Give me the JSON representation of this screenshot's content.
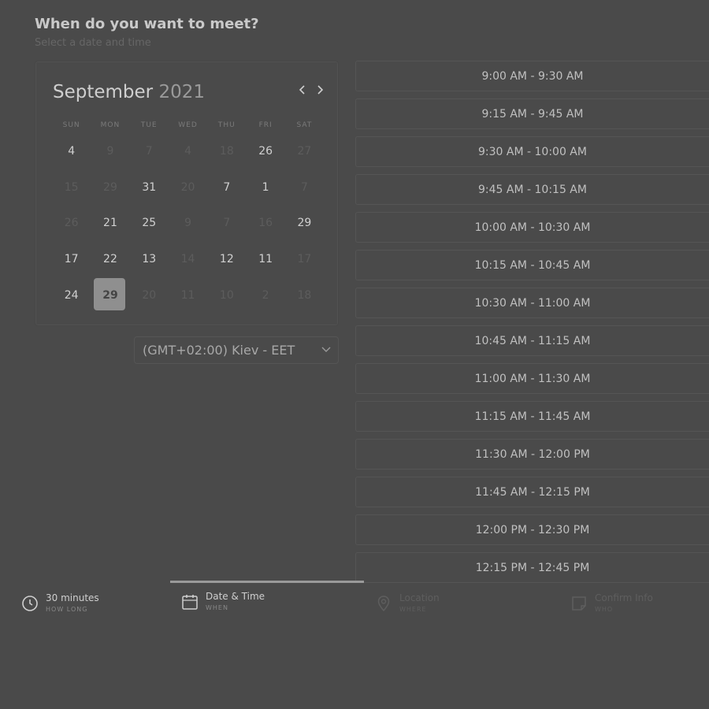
{
  "header": {
    "title": "When do you want to meet?",
    "subtitle": "Select a date and time"
  },
  "calendar": {
    "month": "September",
    "year": "2021",
    "prev_icon": "chevron-left-icon",
    "next_icon": "chevron-right-icon",
    "weekdays": [
      "SUN",
      "MON",
      "TUE",
      "WED",
      "THU",
      "FRI",
      "SAT"
    ],
    "weeks": [
      [
        {
          "d": "4",
          "active": true
        },
        {
          "d": "9",
          "active": false
        },
        {
          "d": "7",
          "active": false
        },
        {
          "d": "4",
          "active": false
        },
        {
          "d": "18",
          "active": false
        },
        {
          "d": "26",
          "active": true
        },
        {
          "d": "27",
          "active": false
        }
      ],
      [
        {
          "d": "15",
          "active": false
        },
        {
          "d": "29",
          "active": false
        },
        {
          "d": "31",
          "active": true
        },
        {
          "d": "20",
          "active": false
        },
        {
          "d": "7",
          "active": true
        },
        {
          "d": "1",
          "active": true
        },
        {
          "d": "7",
          "active": false
        }
      ],
      [
        {
          "d": "26",
          "active": false
        },
        {
          "d": "21",
          "active": true
        },
        {
          "d": "25",
          "active": true
        },
        {
          "d": "9",
          "active": false
        },
        {
          "d": "7",
          "active": false
        },
        {
          "d": "16",
          "active": false
        },
        {
          "d": "29",
          "active": true
        }
      ],
      [
        {
          "d": "17",
          "active": true
        },
        {
          "d": "22",
          "active": true
        },
        {
          "d": "13",
          "active": true
        },
        {
          "d": "14",
          "active": false
        },
        {
          "d": "12",
          "active": true
        },
        {
          "d": "11",
          "active": true
        },
        {
          "d": "17",
          "active": false
        }
      ],
      [
        {
          "d": "24",
          "active": true
        },
        {
          "d": "29",
          "active": true,
          "selected": true
        },
        {
          "d": "20",
          "active": false
        },
        {
          "d": "11",
          "active": false
        },
        {
          "d": "10",
          "active": false
        },
        {
          "d": "2",
          "active": false
        },
        {
          "d": "18",
          "active": false
        }
      ]
    ]
  },
  "timezone": {
    "value": "(GMT+02:00) Kiev - EET",
    "icon": "chevron-down-icon"
  },
  "time_slots": [
    "9:00 AM - 9:30 AM",
    "9:15 AM - 9:45 AM",
    "9:30 AM - 10:00 AM",
    "9:45 AM - 10:15 AM",
    "10:00 AM - 10:30 AM",
    "10:15 AM - 10:45 AM",
    "10:30 AM - 11:00 AM",
    "10:45 AM - 11:15 AM",
    "11:00 AM - 11:30 AM",
    "11:15 AM - 11:45 AM",
    "11:30 AM - 12:00 PM",
    "11:45 AM - 12:15 PM",
    "12:00 PM - 12:30 PM",
    "12:15 PM - 12:45 PM"
  ],
  "steps": {
    "duration": {
      "label": "30 minutes",
      "sub": "HOW LONG",
      "icon": "clock-icon"
    },
    "datetime": {
      "label": "Date & Time",
      "sub": "WHEN",
      "icon": "calendar-icon"
    },
    "location": {
      "label": "Location",
      "sub": "WHERE",
      "icon": "map-pin-icon"
    },
    "confirm": {
      "label": "Confirm Info",
      "sub": "WHO",
      "icon": "note-icon"
    }
  },
  "colors": {
    "background": "#4a4a4a",
    "selected_day": "#8f8f8f",
    "progress": "#9a9a9a"
  }
}
